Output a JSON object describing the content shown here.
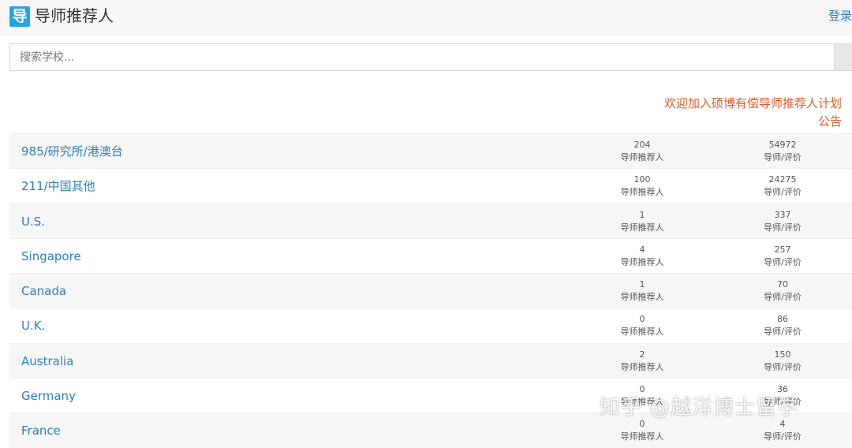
{
  "header": {
    "logo_glyph": "导",
    "title": "导师推荐人",
    "login_label": "登录"
  },
  "search": {
    "placeholder": "搜索学校..."
  },
  "announcement": {
    "line1": "欢迎加入硕博有偿导师推荐人计划",
    "line2": "公告"
  },
  "rows": [
    {
      "name": "985/研究所/港澳台",
      "mentors": "204",
      "mentors_label": "导师推荐人",
      "reviews": "54972",
      "reviews_label": "导师/评价"
    },
    {
      "name": "211/中国其他",
      "mentors": "100",
      "mentors_label": "导师推荐人",
      "reviews": "24275",
      "reviews_label": "导师/评价"
    },
    {
      "name": "U.S.",
      "mentors": "1",
      "mentors_label": "导师推荐人",
      "reviews": "337",
      "reviews_label": "导师/评价"
    },
    {
      "name": "Singapore",
      "mentors": "4",
      "mentors_label": "导师推荐人",
      "reviews": "257",
      "reviews_label": "导师/评价"
    },
    {
      "name": "Canada",
      "mentors": "1",
      "mentors_label": "导师推荐人",
      "reviews": "70",
      "reviews_label": "导师/评价"
    },
    {
      "name": "U.K.",
      "mentors": "0",
      "mentors_label": "导师推荐人",
      "reviews": "86",
      "reviews_label": "导师/评价"
    },
    {
      "name": "Australia",
      "mentors": "2",
      "mentors_label": "导师推荐人",
      "reviews": "150",
      "reviews_label": "导师/评价"
    },
    {
      "name": "Germany",
      "mentors": "0",
      "mentors_label": "导师推荐人",
      "reviews": "36",
      "reviews_label": "导师/评价"
    },
    {
      "name": "France",
      "mentors": "0",
      "mentors_label": "导师推荐人",
      "reviews": "4",
      "reviews_label": "导师/评价"
    }
  ],
  "watermark": "知乎 @越洋博士留学",
  "colors": {
    "link": "#2a7fc5",
    "announcement": "#e35b28",
    "logo_bg": "#2aa3dc"
  }
}
